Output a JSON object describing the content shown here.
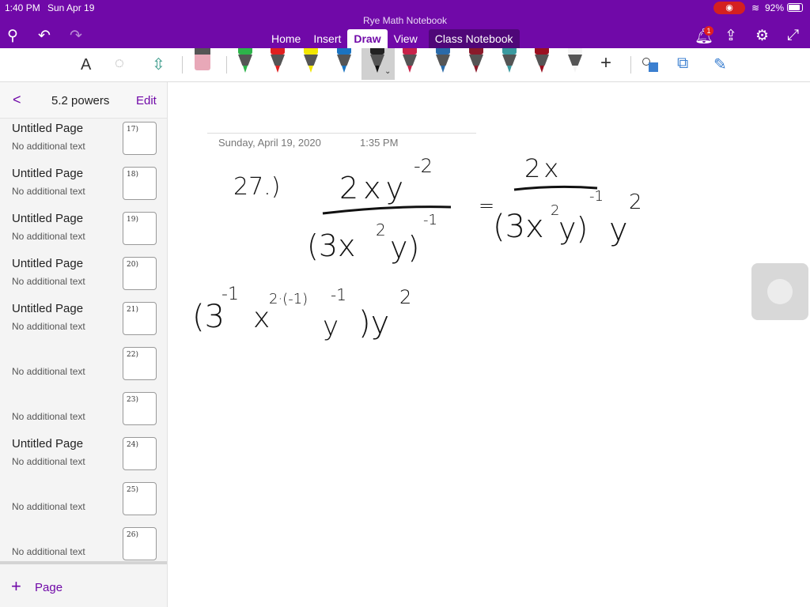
{
  "status": {
    "time": "1:40 PM",
    "date": "Sun Apr 19",
    "battery": "92%"
  },
  "app": {
    "title": "Rye Math Notebook",
    "notification_count": "1"
  },
  "tabs": [
    {
      "label": "Home"
    },
    {
      "label": "Insert"
    },
    {
      "label": "Draw"
    },
    {
      "label": "View"
    },
    {
      "label": "Class Notebook"
    }
  ],
  "toolbar": {
    "text_tool": "A",
    "add": "+"
  },
  "pens": [
    "#2db34a",
    "#e02020",
    "#f2e600",
    "#1a73c0",
    "#222222",
    "#c8234a",
    "#2a6aa8",
    "#8a1a2a",
    "#3a9aa0",
    "#9a1020",
    "#f4f4f4"
  ],
  "sidebar": {
    "back": "<",
    "section": "5.2 powers",
    "edit": "Edit",
    "add_page": "Page",
    "pages": [
      {
        "title": "Untitled Page",
        "sub": "No additional text",
        "thumb": "17)"
      },
      {
        "title": "Untitled Page",
        "sub": "No additional text",
        "thumb": "18)"
      },
      {
        "title": "Untitled Page",
        "sub": "No additional text",
        "thumb": "19)"
      },
      {
        "title": "Untitled Page",
        "sub": "No additional text",
        "thumb": "20)"
      },
      {
        "title": "Untitled Page",
        "sub": "No additional text",
        "thumb": "21)"
      },
      {
        "title": "",
        "sub": "No additional text",
        "thumb": "22)"
      },
      {
        "title": "",
        "sub": "No additional text",
        "thumb": "23)"
      },
      {
        "title": "Untitled Page",
        "sub": "No additional text",
        "thumb": "24)"
      },
      {
        "title": "",
        "sub": "No additional text",
        "thumb": "25)"
      },
      {
        "title": "",
        "sub": "No additional text",
        "thumb": "26)"
      }
    ]
  },
  "page": {
    "date": "Sunday, April 19, 2020",
    "time": "1:35 PM",
    "ink": {
      "num": "27.)",
      "n1": "2xy",
      "e1": "-2",
      "d1": "(3x",
      "d1e": "2",
      "d1y": "y)",
      "d1exp": "-1",
      "eq": "=",
      "rn": "2x",
      "rd": "(3x",
      "rde": "2",
      "rdy": "y)",
      "rdexp": "-1",
      "ry": "y",
      "rye": "2",
      "l2a": "(3",
      "l2ae": "-1",
      "l2x": "x",
      "l2xe": "2·(-1)",
      "l2y": "y",
      "l2ye": "-1",
      "l2c": ")y",
      "l2ce": "2"
    }
  }
}
